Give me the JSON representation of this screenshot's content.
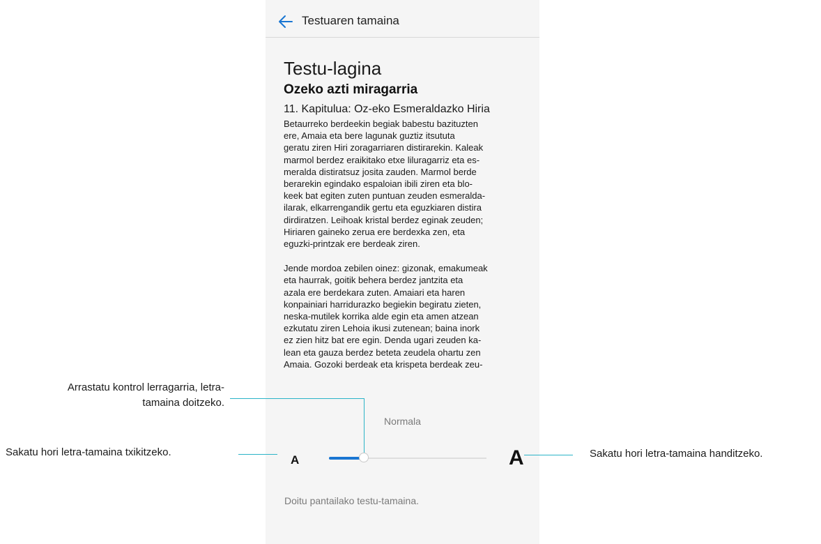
{
  "header": {
    "title": "Testuaren tamaina",
    "back_icon": "arrow-left-icon"
  },
  "sample": {
    "label": "Testu-lagina",
    "book_title": "Ozeko azti miragarria",
    "chapter": "11. Kapitulua: Oz-eko Esmeraldazko Hiria",
    "paragraphs": [
      [
        "Betaurreko berdeekin begiak babestu bazituzten",
        "ere, Amaia eta bere lagunak guztiz itsututa",
        "geratu ziren Hiri zoragarriaren distirarekin. Kaleak",
        "marmol berdez eraikitako etxe liluragarriz eta es-",
        "meralda distiratsuz josita zauden. Marmol berde",
        "berarekin egindako espaloian ibili ziren eta blo-",
        "keek bat egiten zuten puntuan zeuden esmeralda-",
        "ilarak, elkarrengandik gertu eta eguzkiaren distira",
        "dirdiratzen. Leihoak kristal berdez eginak zeuden;",
        "Hiriaren gaineko zerua ere berdexka zen, eta",
        "eguzki-printzak ere berdeak ziren."
      ],
      [
        "Jende mordoa zebilen oinez: gizonak, emakumeak",
        "eta haurrak, goitik behera berdez jantzita eta",
        "azala ere berdekara zuten. Amaiari eta haren",
        "konpainiari harridurazko begiekin begiratu zieten,",
        "neska-mutilek korrika alde egin eta amen atzean",
        "ezkutatu ziren Lehoia ikusi zutenean; baina inork",
        "ez zien hitz bat ere egin. Denda ugari zeuden ka-",
        "lean eta gauza berdez beteta zeudela ohartu zen",
        "Amaia. Gozoki berdeak eta krispeta berdeak zeu-"
      ]
    ]
  },
  "font_size": {
    "current_label": "Normala",
    "small_label": "A",
    "large_label": "A",
    "slider_level": 0.2,
    "accent_color": "#1976d2"
  },
  "footer": {
    "hint": "Doitu pantailako testu-tamaina."
  },
  "callouts": {
    "slider": [
      "Arrastatu kontrol lerragarria, letra-",
      "tamaina doitzeko."
    ],
    "small": "Sakatu hori letra-tamaina txikitzeko.",
    "large": "Sakatu hori letra-tamaina handitzeko."
  }
}
